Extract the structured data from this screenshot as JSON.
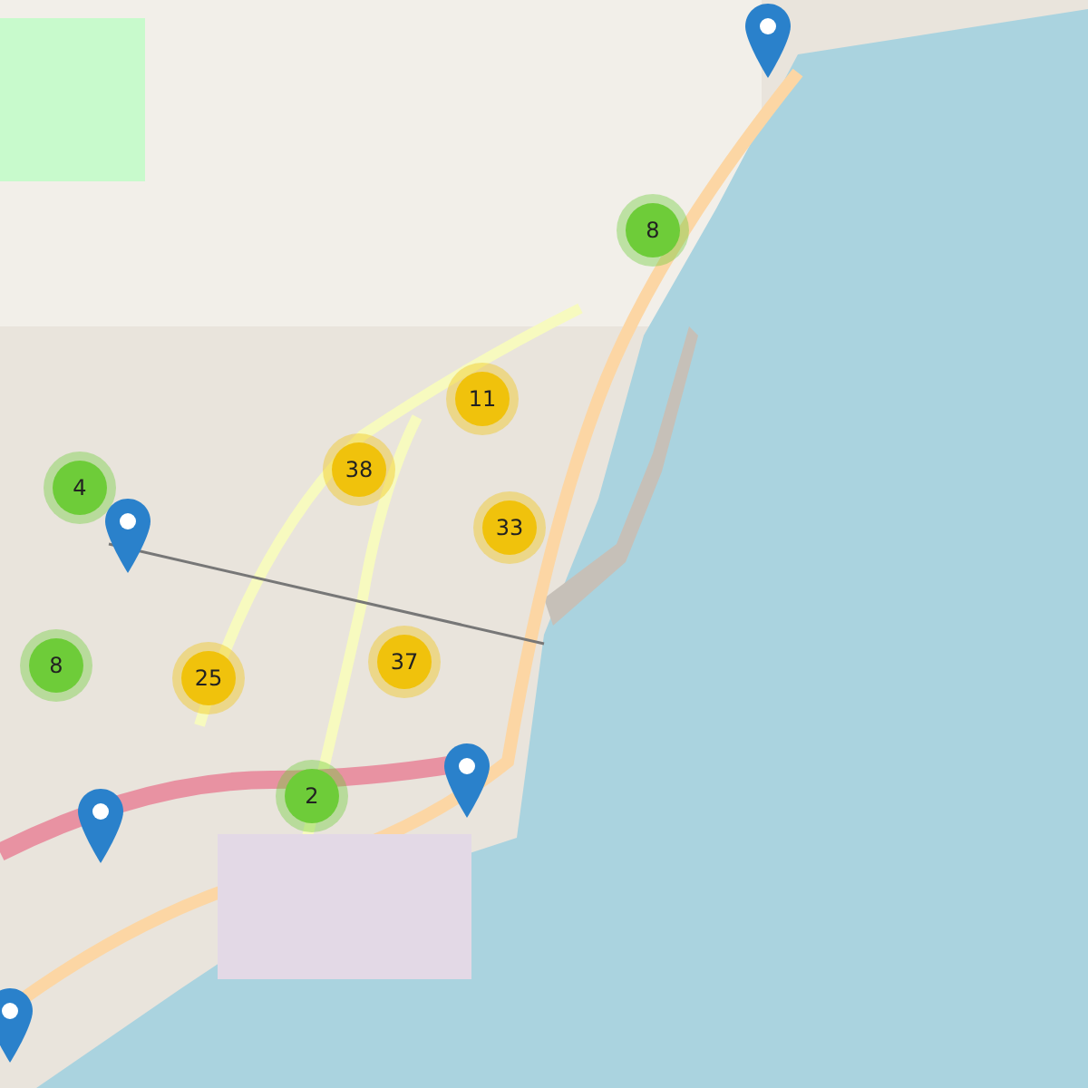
{
  "clusters": [
    {
      "count": "8",
      "color": "#6ecc39"
    },
    {
      "count": "11",
      "color": "#f0c20c"
    },
    {
      "count": "4",
      "color": "#6ecc39"
    },
    {
      "count": "38",
      "color": "#f0c20c"
    },
    {
      "count": "33",
      "color": "#f0c20c"
    },
    {
      "count": "8",
      "color": "#6ecc39"
    },
    {
      "count": "25",
      "color": "#f0c20c"
    },
    {
      "count": "37",
      "color": "#f0c20c"
    },
    {
      "count": "2",
      "color": "#6ecc39"
    }
  ],
  "pins": [
    {
      "kind": "pin"
    },
    {
      "kind": "pin"
    },
    {
      "kind": "pin"
    },
    {
      "kind": "pin"
    },
    {
      "kind": "pin"
    }
  ]
}
